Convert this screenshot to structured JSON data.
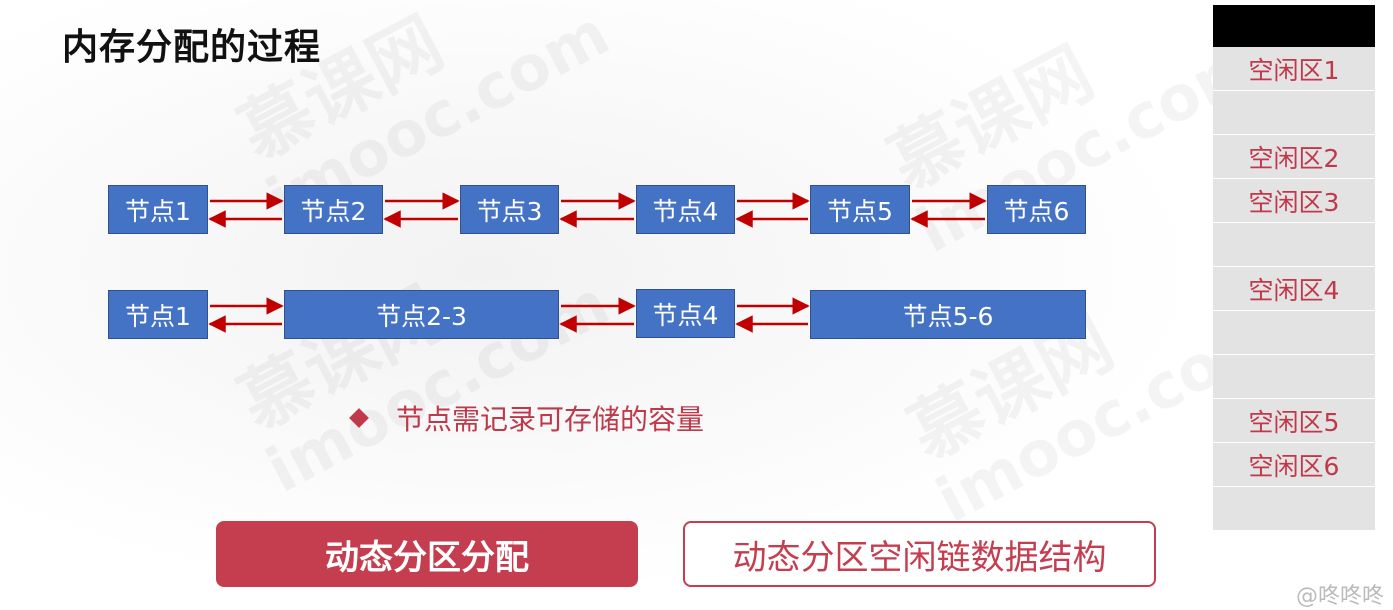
{
  "title": "内存分配的过程",
  "watermark": [
    "慕课网",
    "imooc.com"
  ],
  "row1_nodes": [
    "节点1",
    "节点2",
    "节点3",
    "节点4",
    "节点5",
    "节点6"
  ],
  "row2_nodes": [
    "节点1",
    "节点2-3",
    "节点4",
    "节点5-6"
  ],
  "bullet_text": "节点需记录可存储的容量",
  "buttons": {
    "dynamic_alloc": "动态分区分配",
    "free_list": "动态分区空闲链数据结构"
  },
  "memory_cells": [
    "空闲区1",
    "",
    "空闲区2",
    "空闲区3",
    "",
    "空闲区4",
    "",
    "",
    "空闲区5",
    "空闲区6",
    ""
  ],
  "credit": "@咚咚咚",
  "colors": {
    "node_fill": "#4472c4",
    "arrow": "#c00000",
    "accent": "#c43e50",
    "memory_cell": "#e3e3e3"
  }
}
